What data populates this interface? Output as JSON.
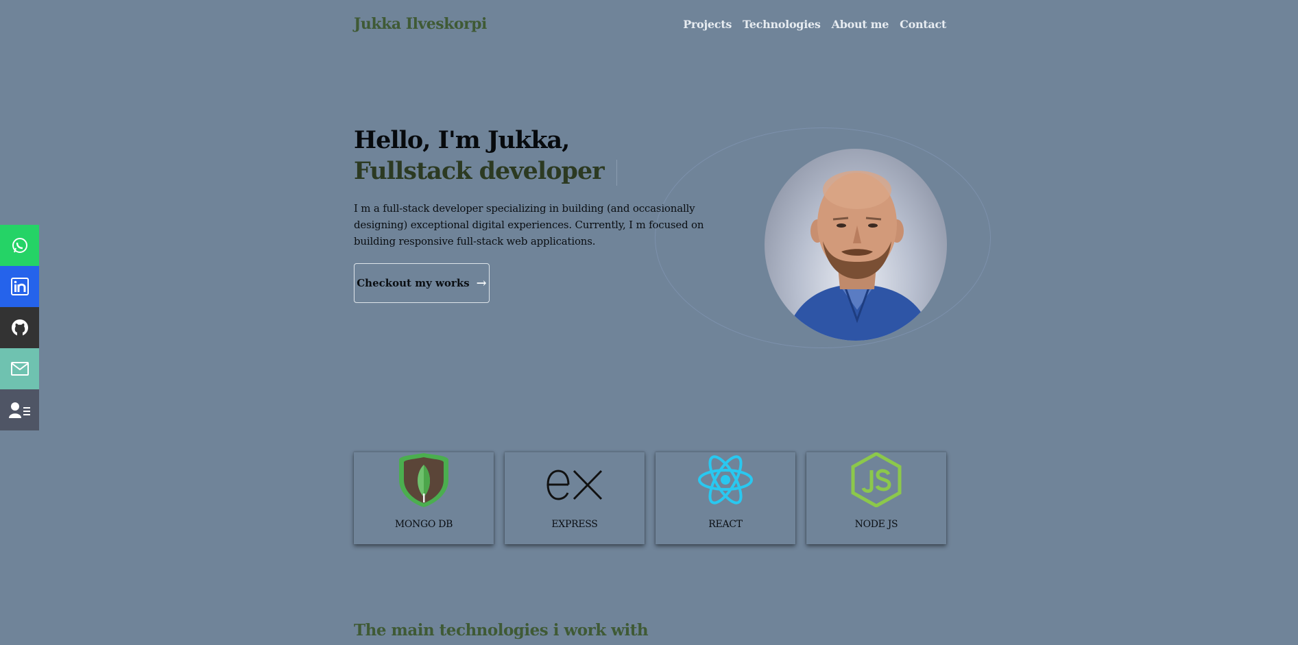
{
  "header": {
    "brand": "Jukka Ilveskorpi",
    "nav": [
      "Projects",
      "Technologies",
      "About me",
      "Contact"
    ]
  },
  "hero": {
    "title_line1": "Hello, I'm Jukka,",
    "title_line2": "Fullstack developer",
    "description": "I m a full-stack developer specializing in building (and occasionally designing) exceptional digital experiences. Currently, I m focused on building responsive full-stack web applications.",
    "cta_label": "Checkout my works",
    "cta_arrow": "→"
  },
  "social": [
    {
      "name": "whatsapp",
      "color": "#25d366"
    },
    {
      "name": "linkedin",
      "color": "#2563eb"
    },
    {
      "name": "github",
      "color": "#333333"
    },
    {
      "name": "email",
      "color": "#6fc2b0"
    },
    {
      "name": "resume",
      "color": "#4f5565"
    }
  ],
  "technologies": [
    {
      "label": "MONGO DB"
    },
    {
      "label": "EXPRESS"
    },
    {
      "label": "REACT"
    },
    {
      "label": "NODE JS"
    }
  ],
  "section": {
    "title": "The main technologies i work with"
  },
  "colors": {
    "background": "#708499",
    "brand": "#3f5a35",
    "nav": "#e7ecf1"
  }
}
